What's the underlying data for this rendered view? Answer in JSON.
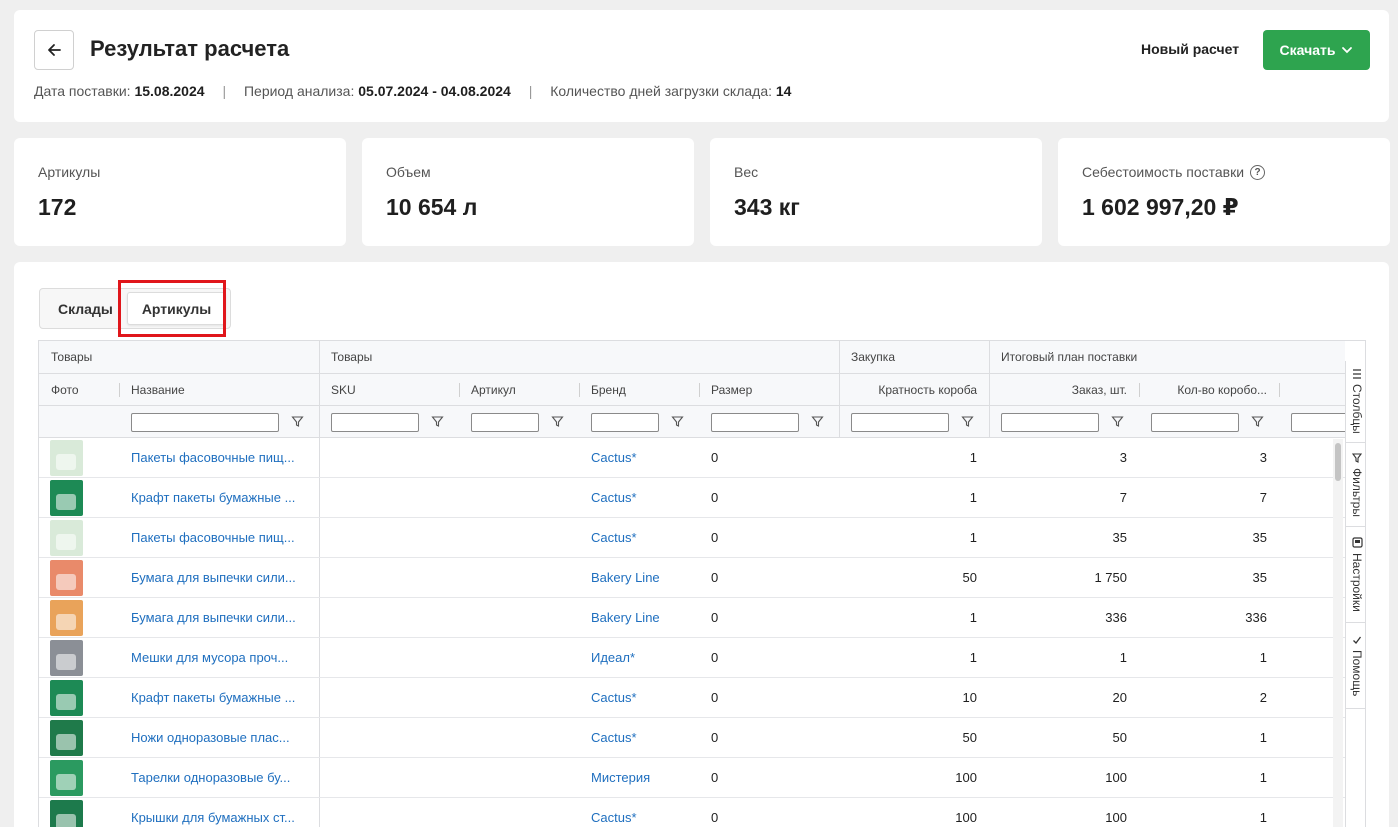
{
  "header": {
    "title": "Результат расчета",
    "back_icon": "arrow-left-icon",
    "meta": {
      "delivery_label": "Дата поставки:",
      "delivery_value": "15.08.2024",
      "period_label": "Период анализа:",
      "period_value": "05.07.2024 - 04.08.2024",
      "days_label": "Количество дней загрузки склада:",
      "days_value": "14",
      "separator": "|"
    },
    "new_calc_label": "Новый расчет",
    "download_label": "Скачать"
  },
  "stats": [
    {
      "label": "Артикулы",
      "value": "172"
    },
    {
      "label": "Объем",
      "value": "10 654 л"
    },
    {
      "label": "Вес",
      "value": "343 кг"
    },
    {
      "label": "Себестоимость поставки",
      "value": "1 602 997,20 ₽",
      "help": "?"
    }
  ],
  "tabs": [
    {
      "label": "Склады",
      "active": false
    },
    {
      "label": "Артикулы",
      "active": true
    }
  ],
  "grid": {
    "groups": [
      "Товары",
      "Товары",
      "Закупка",
      "Итоговый план поставки"
    ],
    "columns": [
      "Фото",
      "Название",
      "SKU",
      "Артикул",
      "Бренд",
      "Размер",
      "Кратность короба",
      "Заказ, шт.",
      "Кол-во коробо..."
    ],
    "rows": [
      {
        "name": "Пакеты фасовочные пищ...",
        "brand": "Cactus*",
        "size": "0",
        "multiplicity": "1",
        "order": "3",
        "boxes": "3",
        "thumb": "#d9ead9"
      },
      {
        "name": "Крафт пакеты бумажные ...",
        "brand": "Cactus*",
        "size": "0",
        "multiplicity": "1",
        "order": "7",
        "boxes": "7",
        "thumb": "#1d8a55"
      },
      {
        "name": "Пакеты фасовочные пищ...",
        "brand": "Cactus*",
        "size": "0",
        "multiplicity": "1",
        "order": "35",
        "boxes": "35",
        "thumb": "#d9ead9"
      },
      {
        "name": "Бумага для выпечки сили...",
        "brand": "Bakery Line",
        "size": "0",
        "multiplicity": "50",
        "order": "1 750",
        "boxes": "35",
        "thumb": "#e98a6a"
      },
      {
        "name": "Бумага для выпечки сили...",
        "brand": "Bakery Line",
        "size": "0",
        "multiplicity": "1",
        "order": "336",
        "boxes": "336",
        "thumb": "#e9a35a"
      },
      {
        "name": "Мешки для мусора проч...",
        "brand": "Идеал*",
        "size": "0",
        "multiplicity": "1",
        "order": "1",
        "boxes": "1",
        "thumb": "#8b8f96"
      },
      {
        "name": "Крафт пакеты бумажные ...",
        "brand": "Cactus*",
        "size": "0",
        "multiplicity": "10",
        "order": "20",
        "boxes": "2",
        "thumb": "#1d8a55"
      },
      {
        "name": "Ножи одноразовые плас...",
        "brand": "Cactus*",
        "size": "0",
        "multiplicity": "50",
        "order": "50",
        "boxes": "1",
        "thumb": "#1f7a4a"
      },
      {
        "name": "Тарелки одноразовые бу...",
        "brand": "Мистерия",
        "size": "0",
        "multiplicity": "100",
        "order": "100",
        "boxes": "1",
        "thumb": "#2b9a60"
      },
      {
        "name": "Крышки для бумажных ст...",
        "brand": "Cactus*",
        "size": "0",
        "multiplicity": "100",
        "order": "100",
        "boxes": "1",
        "thumb": "#1d7a4c"
      }
    ]
  },
  "side_panel": [
    {
      "label": "Столбцы",
      "icon": "columns-icon"
    },
    {
      "label": "Фильтры",
      "icon": "filter-icon"
    },
    {
      "label": "Настройки",
      "icon": "settings-icon"
    },
    {
      "label": "Помощь",
      "icon": "check-icon"
    }
  ],
  "colors": {
    "accent": "#2ea44f",
    "link": "#1f6fbf",
    "highlight": "#e0161b"
  }
}
